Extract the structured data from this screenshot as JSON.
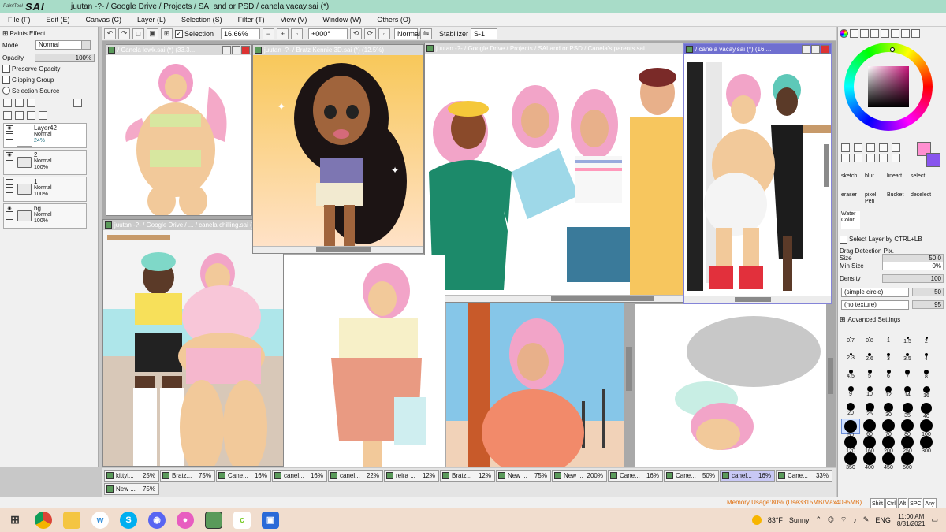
{
  "app": {
    "logo_small": "PaintTool",
    "logo_big": "SAI",
    "window_title": "juutan -?- / Google Drive / Projects / SAI and or PSD / canela vacay.sai (*)"
  },
  "menu": [
    "File (F)",
    "Edit (E)",
    "Canvas (C)",
    "Layer (L)",
    "Selection (S)",
    "Filter (T)",
    "View (V)",
    "Window (W)",
    "Others (O)"
  ],
  "toolbar": {
    "selection_label": "Selection",
    "zoom": "16.66%",
    "rotation": "+000°",
    "blend": "Normal",
    "stabilizer_label": "Stabilizer",
    "stabilizer_value": "S-1"
  },
  "left_panel": {
    "paints_effect": "Paints Effect",
    "mode_label": "Mode",
    "mode_value": "Normal",
    "opacity_label": "Opacity",
    "opacity_value": "100%",
    "preserve_opacity": "Preserve Opacity",
    "clipping_group": "Clipping Group",
    "selection_source": "Selection Source",
    "layers": [
      {
        "name": "Layer42",
        "mode": "Normal",
        "opacity": "24%"
      },
      {
        "name": "2",
        "mode": "Normal",
        "opacity": "100%"
      },
      {
        "name": "1",
        "mode": "Normal",
        "opacity": "100%"
      },
      {
        "name": "bg",
        "mode": "Normal",
        "opacity": "100%"
      }
    ]
  },
  "windows": [
    {
      "title": "/ Canela lewk.sai (*) (33.3..."
    },
    {
      "title": "juutan -?- / Google Drive / ... / canela chilling.sai (*)"
    },
    {
      "title": "juutan -?- / Bratz Kennie 3D.sai (*) (12.5%)"
    },
    {
      "title": "juutan -?- / Google Drive / Projects / SAI and or PSD / Canela's parents.sai"
    },
    {
      "title": "/ canela vacay.sai (*) (16...."
    }
  ],
  "tabs": [
    {
      "name": "kittyi...",
      "zoom": "25%"
    },
    {
      "name": "Bratz...",
      "zoom": "75%"
    },
    {
      "name": "Cane...",
      "zoom": "16%"
    },
    {
      "name": "canel...",
      "zoom": "16%"
    },
    {
      "name": "canel...",
      "zoom": "22%"
    },
    {
      "name": "reira ...",
      "zoom": "12%"
    },
    {
      "name": "Bratz...",
      "zoom": "12%"
    },
    {
      "name": "New ...",
      "zoom": "75%"
    },
    {
      "name": "New ...",
      "zoom": "200%"
    },
    {
      "name": "Cane...",
      "zoom": "16%"
    },
    {
      "name": "Cane...",
      "zoom": "50%"
    },
    {
      "name": "canel...",
      "zoom": "16%"
    },
    {
      "name": "Cane...",
      "zoom": "33%"
    },
    {
      "name": "New ...",
      "zoom": "75%"
    }
  ],
  "right_panel": {
    "tools": [
      {
        "name": "sketch"
      },
      {
        "name": "blur"
      },
      {
        "name": "lineart"
      },
      {
        "name": "select"
      },
      {
        "name": "eraser"
      },
      {
        "name": "pixel Pen"
      },
      {
        "name": "Bucket"
      },
      {
        "name": "deselect"
      },
      {
        "name": "Water Color"
      }
    ],
    "select_layer": "Select Layer by CTRL+LB",
    "drag_detection": "Drag Detection Pix.",
    "size_label": "Size",
    "size_value": "50.0",
    "min_size_label": "Min Size",
    "min_size_value": "0%",
    "density_label": "Density",
    "density_value": "100",
    "shape": "(simple circle)",
    "shape_value": "50",
    "texture": "(no texture)",
    "texture_value": "95",
    "advanced": "Advanced Settings",
    "brush_sizes": [
      "0.7",
      "0.8",
      "1",
      "1.5",
      "2",
      "2.3",
      "2.6",
      "3",
      "3.5",
      "4",
      "4.5",
      "5",
      "6",
      "7",
      "8",
      "9",
      "10",
      "12",
      "14",
      "16",
      "20",
      "25",
      "30",
      "35",
      "40",
      "50",
      "60",
      "70",
      "80",
      "100",
      "120",
      "160",
      "200",
      "250",
      "300",
      "350",
      "400",
      "450",
      "500"
    ],
    "selected_size": "50"
  },
  "status": {
    "memory": "Memory Usage:80% (Use3315MB/Max4095MB)",
    "keys": [
      "Shift",
      "Ctrl",
      "Alt",
      "SPC",
      "Any"
    ]
  },
  "taskbar": {
    "apps": [
      "windows-icon",
      "chrome-icon",
      "files-icon",
      "w-icon",
      "skype-icon",
      "discord-icon",
      "badge-icon",
      "sai-icon",
      "clipstudio-icon",
      "app-icon"
    ],
    "weather_temp": "83°F",
    "weather_text": "Sunny",
    "language": "ENG",
    "time": "11:00 AM",
    "date": "8/31/2021"
  },
  "colors": {
    "titlebar": "#a8dcc8",
    "primary_color": "#ff8fd0",
    "secondary_color": "#8855ee",
    "active_window": "#6f6fd0",
    "memory_text": "#e07010"
  }
}
